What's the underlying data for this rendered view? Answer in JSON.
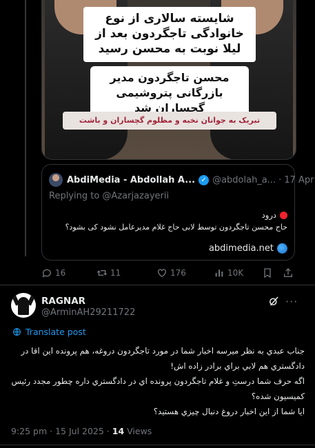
{
  "media": {
    "caption_top": "شایسته سالاری از نوع خانوادگی تاجگردون بعد از لیلا نوبت به محسن رسید",
    "caption_mid": "محسن تاجگردون مدیر بازرگانی پتروشیمی گچساران شد",
    "caption_bottom": "تبریک به جوانان نخبه و مظلوم گچساران و باشت"
  },
  "quote": {
    "name": "AbdiMedia - Abdollah A...",
    "handle": "@abdolah_a...",
    "dot": "·",
    "date": "17 Apr",
    "replying": "Replying to @Azarjazayerii",
    "line1": "درود",
    "line2": "حاج محسن تاجگردون توسط لابی حاج غلام مدیرعامل نشود کی بشود؟",
    "link": "abdimedia.net"
  },
  "actions": {
    "replies": "16",
    "retweets": "11",
    "likes": "176",
    "views": "10K"
  },
  "tweet": {
    "name": "RAGNAR",
    "handle": "@ArminAH29211722",
    "translate": "Translate post",
    "lines": [
      "جناب عبدي به نظر ميرسه اخبار شما در مورد تاجگردون دروغه، هم پرونده اين اقا در",
      "دادگستري هم لابي براي برادر زاده اش!",
      "اگه حرف شما درستِ و غلام تاجگردون پرونده اي در دادگستري داره چطور مجدد رئيس",
      "كميسيون شده؟",
      "ايا شما از اين اخبار دروغ دنبال چيزي هستيد؟"
    ],
    "time": "9:25 pm · 15 Jul 2025 · ",
    "views_count": "14",
    "views_label": " Views"
  }
}
